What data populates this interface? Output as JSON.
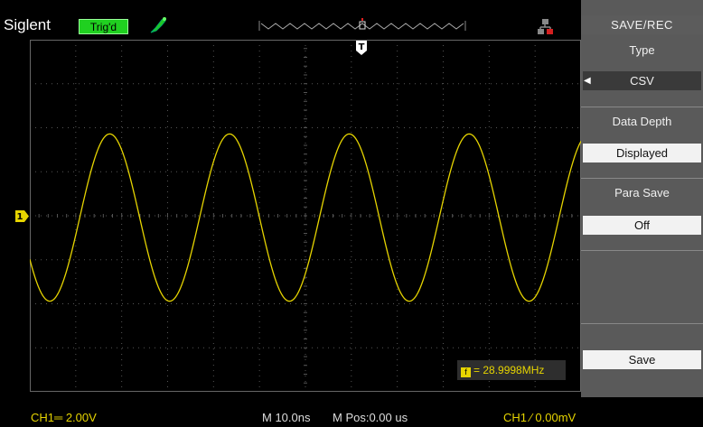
{
  "status": {
    "brand": "Siglent",
    "trigger_state": "Trig'd",
    "freq_readout": "= 28.9998MHz",
    "ch1_scale": "CH1═ 2.00V",
    "timebase": "M 10.0ns",
    "mpos": "M Pos:0.00 us",
    "trigger": "CH1 ⁄ 0.00mV",
    "marker_trigger": "T",
    "marker_ch1": "1"
  },
  "menu": {
    "title": "SAVE/REC",
    "type_label": "Type",
    "type_value": "CSV",
    "depth_label": "Data Depth",
    "depth_value": "Displayed",
    "para_label": "Para Save",
    "para_value": "Off",
    "save_label": "Save"
  },
  "colors": {
    "trace": "#e6d400",
    "grid": "#555555",
    "menu_bg": "#5a5a5a",
    "trig_badge": "#20d020"
  },
  "waveform": {
    "cycles_shown": 4.6,
    "phase_start_deg": 210,
    "amplitude_div": 1.9
  }
}
